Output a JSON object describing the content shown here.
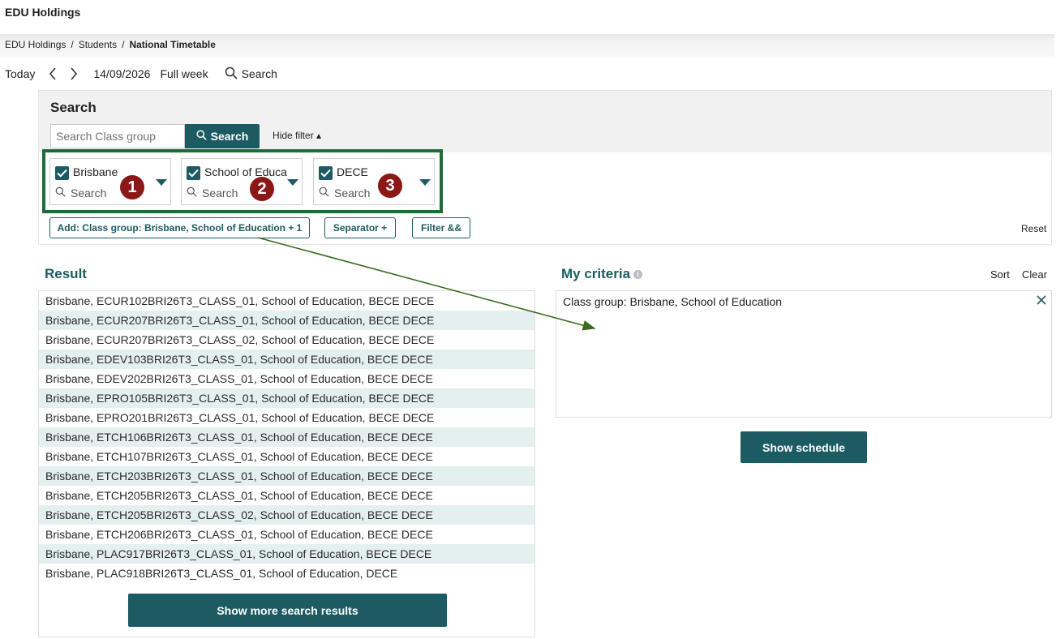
{
  "app": {
    "title": "EDU Holdings"
  },
  "breadcrumb": {
    "items": [
      "EDU Holdings",
      "Students"
    ],
    "current": "National Timetable",
    "separator": "/"
  },
  "toolbar": {
    "today_label": "Today",
    "date": "14/09/2026",
    "range_label": "Full week",
    "search_label": "Search"
  },
  "search_panel": {
    "heading": "Search",
    "input_placeholder": "Search Class group",
    "search_button_label": "Search",
    "hide_filter_label": "Hide filter ▴",
    "filters": [
      {
        "label": "Brisbane",
        "checked": true,
        "search_placeholder": "Search",
        "badge": "1"
      },
      {
        "label": "School of Educa",
        "checked": true,
        "search_placeholder": "Search",
        "badge": "2"
      },
      {
        "label": "DECE",
        "checked": true,
        "search_placeholder": "Search",
        "badge": "3"
      }
    ],
    "chips": [
      "Add: Class group: Brisbane, School of Education + 1",
      "Separator +",
      "Filter &&"
    ],
    "reset_label": "Reset"
  },
  "result": {
    "title": "Result",
    "rows": [
      "Brisbane, ECUR102BRI26T3_CLASS_01, School of Education, BECE DECE",
      "Brisbane, ECUR207BRI26T3_CLASS_01, School of Education, BECE DECE",
      "Brisbane, ECUR207BRI26T3_CLASS_02, School of Education, BECE DECE",
      "Brisbane, EDEV103BRI26T3_CLASS_01, School of Education, BECE DECE",
      "Brisbane, EDEV202BRI26T3_CLASS_01, School of Education, BECE DECE",
      "Brisbane, EPRO105BRI26T3_CLASS_01, School of Education, BECE DECE",
      "Brisbane, EPRO201BRI26T3_CLASS_01, School of Education, BECE DECE",
      "Brisbane, ETCH106BRI26T3_CLASS_01, School of Education, BECE DECE",
      "Brisbane, ETCH107BRI26T3_CLASS_01, School of Education, BECE DECE",
      "Brisbane, ETCH203BRI26T3_CLASS_01, School of Education, BECE DECE",
      "Brisbane, ETCH205BRI26T3_CLASS_01, School of Education, BECE DECE",
      "Brisbane, ETCH205BRI26T3_CLASS_02, School of Education, BECE DECE",
      "Brisbane, ETCH206BRI26T3_CLASS_01, School of Education, BECE DECE",
      "Brisbane, PLAC917BRI26T3_CLASS_01, School of Education, BECE DECE",
      "Brisbane, PLAC918BRI26T3_CLASS_01, School of Education, DECE"
    ],
    "show_more_label": "Show more search results"
  },
  "criteria": {
    "title": "My criteria",
    "info_icon": "i",
    "sort_label": "Sort",
    "clear_label": "Clear",
    "items": [
      "Class group: Brisbane, School of Education"
    ],
    "show_schedule_label": "Show schedule"
  },
  "colors": {
    "accent": "#1d5b62",
    "highlight_frame": "#1e6b37",
    "badge": "#8b1717",
    "row_alt": "#e4eff0"
  },
  "icons": [
    "chevron-left-icon",
    "chevron-right-icon",
    "search-icon",
    "checkbox-checked-icon",
    "caret-down-icon",
    "info-icon",
    "close-icon",
    "annotation-arrow"
  ]
}
